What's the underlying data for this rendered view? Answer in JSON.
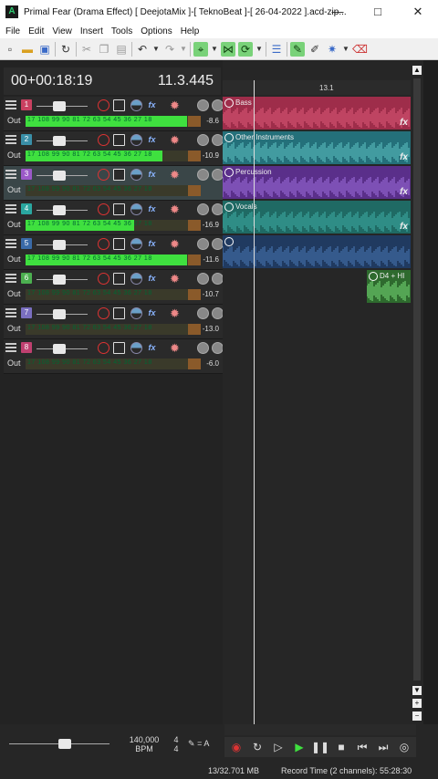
{
  "window": {
    "title": "Primal Fear (Drama Effect) [ DeejotaMix ]-[ TeknoBeat ]-[ 26-04-2022 ].acd-zip...",
    "app_icon": "A",
    "min_icon": "minimize-icon",
    "max_icon": "maximize-icon",
    "close_icon": "close-icon"
  },
  "menu": [
    "File",
    "Edit",
    "View",
    "Insert",
    "Tools",
    "Options",
    "Help"
  ],
  "time": {
    "position": "00+00:18:19",
    "measure": "11.3.445"
  },
  "ruler": {
    "marker": "13.1"
  },
  "tracks": [
    {
      "num": "1",
      "color": "#c94060",
      "db": "-8.6",
      "level": 0.92
    },
    {
      "num": "2",
      "color": "#3a8fa8",
      "db": "-10.9",
      "level": 0.78
    },
    {
      "num": "3",
      "color": "#9b59c8",
      "db": "",
      "level": 0.0
    },
    {
      "num": "4",
      "color": "#2aa7a0",
      "db": "-16.9",
      "level": 0.62
    },
    {
      "num": "5",
      "color": "#3a6aa8",
      "db": "-11.6",
      "level": 0.92
    },
    {
      "num": "6",
      "color": "#4caf50",
      "db": "-10.7",
      "level": 0.0
    },
    {
      "num": "7",
      "color": "#7a6fc0",
      "db": "-13.0",
      "level": 0.0
    },
    {
      "num": "8",
      "color": "#c04070",
      "db": "-6.0",
      "level": 0.0
    }
  ],
  "out_label": "Out",
  "meter_ticks": "17 108  99  90  81  72  63  54  45  36  27  18",
  "clips": [
    {
      "name": "Bass",
      "color": "#9e2d4a",
      "wave": "#e05c7a",
      "fx": "fx"
    },
    {
      "name": "Other Instruments",
      "color": "#24707a",
      "wave": "#5fc6c6",
      "fx": "fx"
    },
    {
      "name": "Percussion",
      "color": "#5a2f8a",
      "wave": "#a070e0",
      "fx": "fx"
    },
    {
      "name": "Vocals",
      "color": "#1f6a64",
      "wave": "#3fb0a8",
      "fx": "fx"
    },
    {
      "name": "",
      "color": "#203a60",
      "wave": "#4a7ab8",
      "fx": ""
    },
    {
      "name": "D4 + HI",
      "color": "#2e6a2e",
      "wave": "#7ae07a",
      "fx": ""
    }
  ],
  "bottom": {
    "bpm": "140,000",
    "bpm_label": "BPM",
    "ts_top": "4",
    "ts_bottom": "4",
    "metro": "= A"
  },
  "status": {
    "memory": "13/32.701 MB",
    "record_time": "Record Time (2 channels): 55:28:30"
  }
}
